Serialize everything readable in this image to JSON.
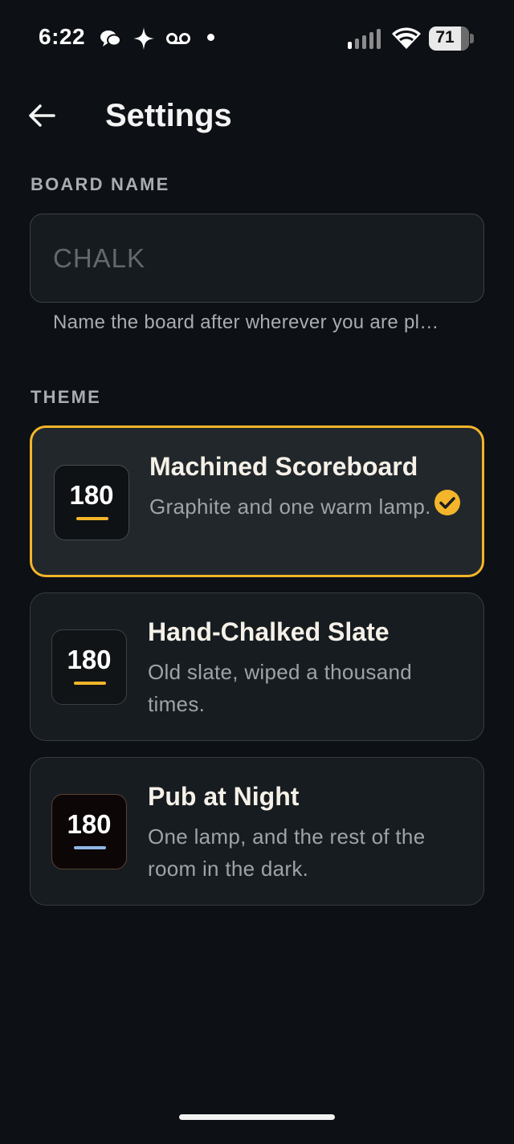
{
  "status_bar": {
    "time": "6:22",
    "battery": "71"
  },
  "header": {
    "title": "Settings"
  },
  "board_name": {
    "label": "BOARD NAME",
    "placeholder": "CHALK",
    "value": "",
    "helper": "Name the board after wherever you are pl…"
  },
  "theme": {
    "label": "THEME",
    "options": [
      {
        "title": "Machined Scoreboard",
        "description": "Graphite and one warm lamp.",
        "preview_number": "180",
        "preview_bg": "#0f1215",
        "preview_accent": "#f4b52a",
        "selected": true
      },
      {
        "title": "Hand-Chalked Slate",
        "description": "Old slate, wiped a thousand times.",
        "preview_number": "180",
        "preview_bg": "#101417",
        "preview_accent": "#f4b52a",
        "selected": false
      },
      {
        "title": "Pub at Night",
        "description": "One lamp, and the rest of the room in the dark.",
        "preview_number": "180",
        "preview_bg": "#0c0706",
        "preview_accent": "#8fb6e6",
        "selected": false
      }
    ]
  },
  "colors": {
    "background": "#0d1014",
    "accent": "#f4b52a",
    "card_border": "#353c42"
  },
  "icons": [
    "chat-bubble-icon",
    "sparkle-icon",
    "voicemail-icon",
    "signal-icon",
    "wifi-icon",
    "battery-icon",
    "back-arrow-icon",
    "check-circle-icon"
  ]
}
